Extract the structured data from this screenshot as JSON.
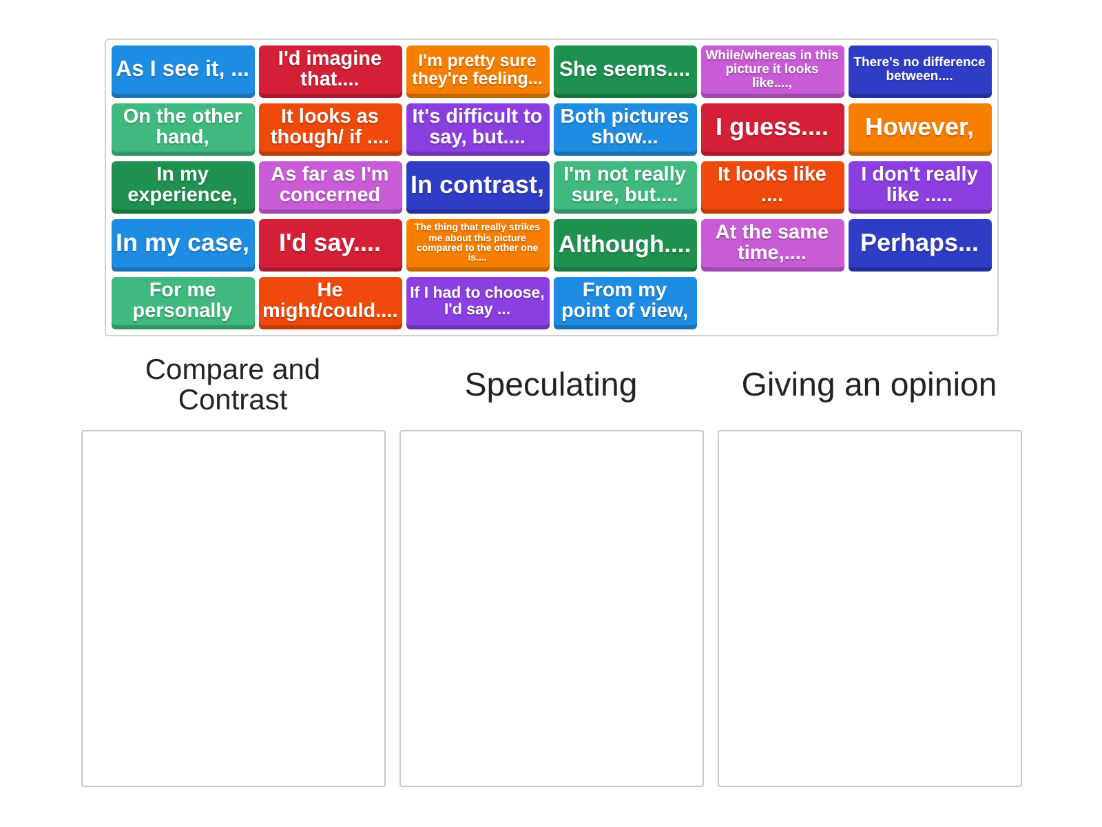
{
  "tiles": [
    {
      "text": "As I see it, ...",
      "color": "#1e8ce3"
    },
    {
      "text": "I'd imagine that....",
      "color": "#d42036"
    },
    {
      "text": "I'm pretty sure they're feeling...",
      "color": "#f77f00"
    },
    {
      "text": "She seems....",
      "color": "#1e9150"
    },
    {
      "text": "While/whereas in this picture it looks like....,",
      "color": "#c95bd6"
    },
    {
      "text": "There's no difference between....",
      "color": "#2f3dc6"
    },
    {
      "text": "On the other hand,",
      "color": "#40b97e"
    },
    {
      "text": "It looks as though/ if ....",
      "color": "#ef4a0b"
    },
    {
      "text": "It's difficult to say, but....",
      "color": "#8b3fe0"
    },
    {
      "text": "Both pictures show...",
      "color": "#1e8ce3"
    },
    {
      "text": "I guess....",
      "color": "#d42036"
    },
    {
      "text": "However,",
      "color": "#f77f00"
    },
    {
      "text": "In my experience,",
      "color": "#1e9150"
    },
    {
      "text": "As far as I'm concerned",
      "color": "#c95bd6"
    },
    {
      "text": "In contrast,",
      "color": "#2f3dc6"
    },
    {
      "text": "I'm not really sure, but....",
      "color": "#40b97e"
    },
    {
      "text": "It looks like ....",
      "color": "#ef4a0b"
    },
    {
      "text": "I don't really like .....",
      "color": "#8b3fe0"
    },
    {
      "text": "In my case,",
      "color": "#1e8ce3"
    },
    {
      "text": "I'd say....",
      "color": "#d42036"
    },
    {
      "text": "The thing that really strikes me about this picture compared to the other one is....",
      "color": "#f77f00"
    },
    {
      "text": "Although....",
      "color": "#1e9150"
    },
    {
      "text": "At the same time,....",
      "color": "#c95bd6"
    },
    {
      "text": "Perhaps...",
      "color": "#2f3dc6"
    },
    {
      "text": "For me personally",
      "color": "#40b97e"
    },
    {
      "text": "He might/could....",
      "color": "#ef4a0b"
    },
    {
      "text": "If I had to choose, I'd say ...",
      "color": "#8b3fe0"
    },
    {
      "text": "From my point of view,",
      "color": "#1e8ce3"
    }
  ],
  "categories": [
    {
      "title": "Compare and Contrast"
    },
    {
      "title": "Speculating"
    },
    {
      "title": "Giving an opinion"
    }
  ]
}
